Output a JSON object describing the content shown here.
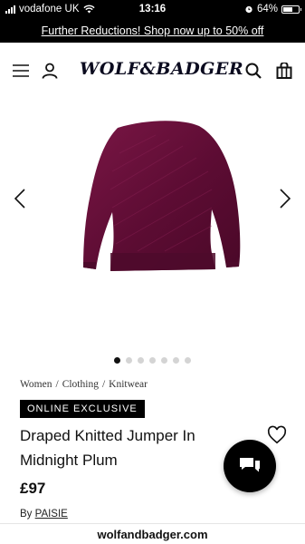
{
  "status_bar": {
    "carrier": "vodafone UK",
    "time": "13:16",
    "battery_level": "64%",
    "battery_fraction": 0.64
  },
  "promo": {
    "text": "Further Reductions! Shop now up to 50% off"
  },
  "header": {
    "logo_text": "WOLF&BADGER",
    "icons": [
      "menu-icon",
      "account-icon",
      "search-icon",
      "bag-icon"
    ]
  },
  "gallery": {
    "image_count": 7,
    "active_index": 0,
    "product_color": "#6b0f3a"
  },
  "breadcrumb": [
    "Women",
    "Clothing",
    "Knitwear"
  ],
  "breadcrumb_separator": "/",
  "product": {
    "badge": "ONLINE EXCLUSIVE",
    "title": "Draped Knitted Jumper In Midnight Plum",
    "price": "£97",
    "by_label": "By",
    "brand": "PAISIE"
  },
  "browser": {
    "url": "wolfandbadger.com"
  }
}
